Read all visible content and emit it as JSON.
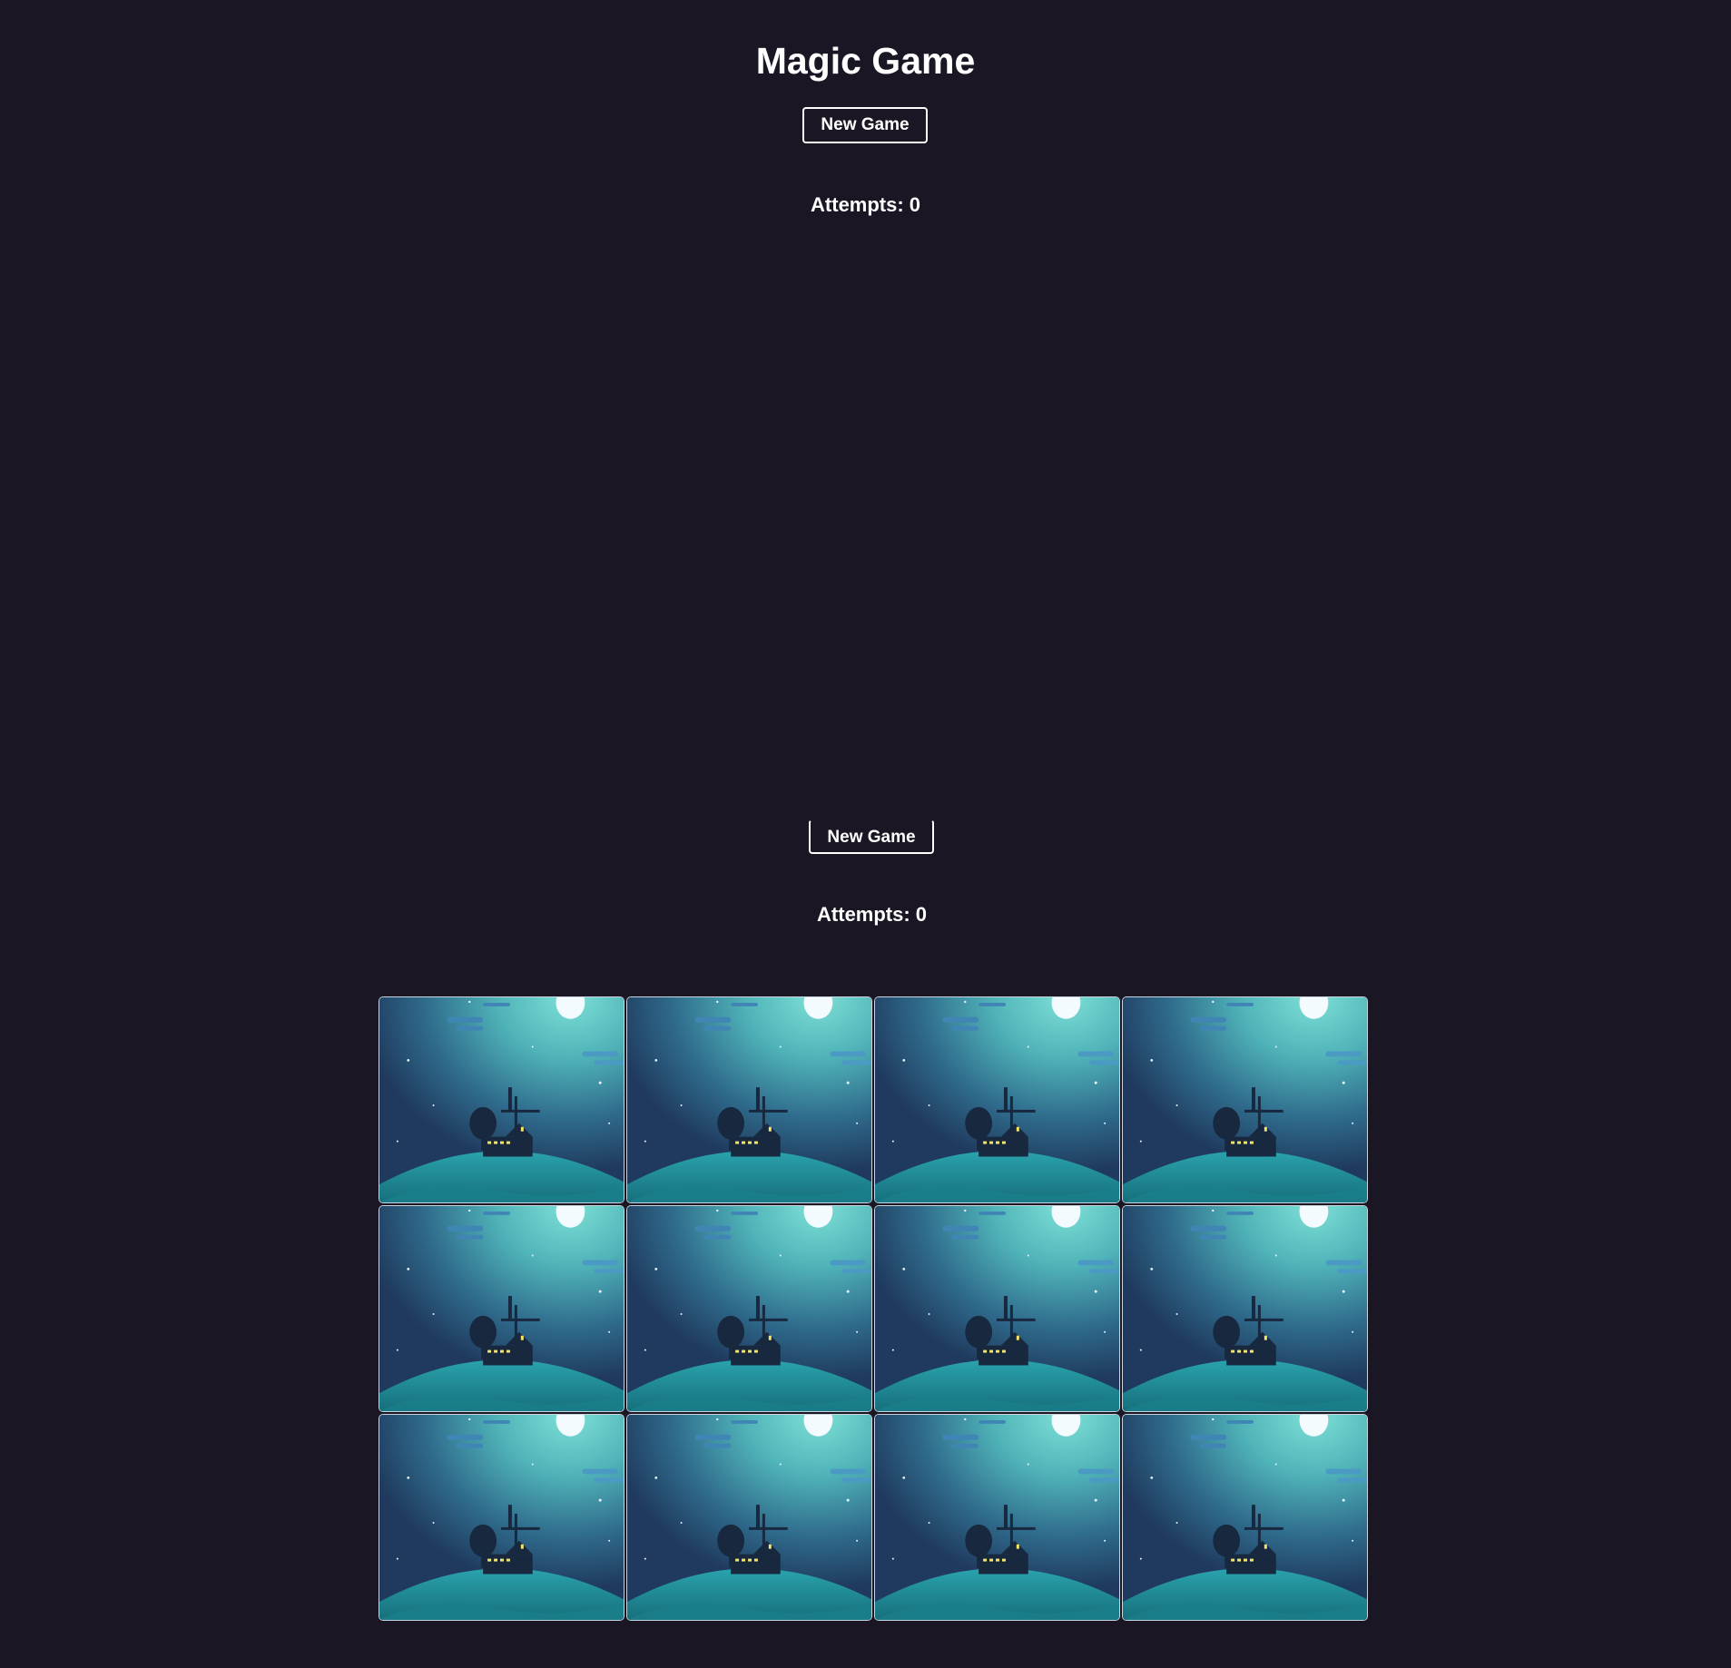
{
  "header": {
    "title": "Magic Game"
  },
  "controls_top": {
    "new_game_label": "New Game",
    "attempts_label": "Attempts:",
    "attempts_value": "0"
  },
  "controls_mid": {
    "new_game_label": "New Game",
    "attempts_label": "Attempts:",
    "attempts_value": "0"
  },
  "board": {
    "rows": 3,
    "columns": 4,
    "card_back_icon": "night-windmill-landscape-icon",
    "cards": [
      {
        "state": "face-down"
      },
      {
        "state": "face-down"
      },
      {
        "state": "face-down"
      },
      {
        "state": "face-down"
      },
      {
        "state": "face-down"
      },
      {
        "state": "face-down"
      },
      {
        "state": "face-down"
      },
      {
        "state": "face-down"
      },
      {
        "state": "face-down"
      },
      {
        "state": "face-down"
      },
      {
        "state": "face-down"
      },
      {
        "state": "face-down"
      }
    ]
  },
  "colors": {
    "background": "#1b1623",
    "text": "#ffffff",
    "card_sky_dark": "#1f3a5e",
    "card_glow": "#5ec4c4",
    "card_hill": "#1f8a95"
  }
}
